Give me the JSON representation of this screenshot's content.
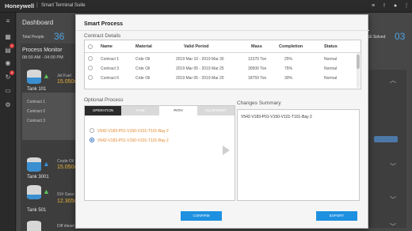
{
  "app": {
    "brand": "Honeywell",
    "separator": "|",
    "suite": "Smart Terminal Suite"
  },
  "background": {
    "dashboard_title": "Dashboard",
    "total_people_label": "Total People",
    "total_people_value": "36",
    "right_label": "SE Solved",
    "right_value": "03",
    "process_monitor_title": "Process Monitor",
    "process_monitor_time": "08:00 AM - 04:00 PM",
    "tanks": [
      {
        "material": "Jet Fuel",
        "flow": "15.050m",
        "name": "Tank 101"
      },
      {
        "material": "Crude Oil",
        "flow": "15.050m",
        "name": "Tank 3001"
      },
      {
        "material": "91# Gaso",
        "flow": "12.305m",
        "name": "Tank 501"
      },
      {
        "material": "Diff diesel",
        "flow": "",
        "name": ""
      }
    ],
    "ops_items": [
      "Contract 1",
      "Contract 2",
      "Contract 3"
    ],
    "nav_badges": [
      "1",
      "4"
    ]
  },
  "modal": {
    "title": "Smart Process",
    "contract_details": {
      "title": "Contract Details",
      "columns": [
        "Name",
        "Material",
        "Valid Period",
        "Mass",
        "Completion",
        "Status"
      ],
      "rows": [
        {
          "name": "Contract 1",
          "material": "Crde Oil",
          "period": "2019 Mar 10 - 2019 Mar 30",
          "mass": "12370 Ton",
          "completion": "25%",
          "status": "Normal"
        },
        {
          "name": "Contract 3",
          "material": "Crde Oil",
          "period": "2019 Mar 05 - 2019 Mar 25",
          "mass": "30500 Ton",
          "completion": "75%",
          "status": "Normal"
        },
        {
          "name": "Contract 6",
          "material": "Crde Oil",
          "period": "2019 Mar 05 - 2019 Mar 20",
          "mass": "18759 Ton",
          "completion": "30%",
          "status": "Normal"
        }
      ]
    },
    "optional_process": {
      "title": "Optional Process",
      "tabs": [
        "OPERATION",
        "TANK",
        "PATH",
        "EQUIPMENT"
      ],
      "options": [
        "V542-V183-P01-V150-V101-T101-Bay 2",
        "V542-V183-P01-V150-V101-T101-Bay 2"
      ],
      "selected_index": 1
    },
    "changes_summary": {
      "title": "Changes Summary",
      "text": "V542-V183-P01-V150-V101-T101-Bay 2"
    },
    "confirm_label": "CONFIRM",
    "export_label": "EXPORT"
  },
  "colors": {
    "accent_blue": "#1e90e0",
    "option_orange": "#e0862a",
    "active_tab": "#2b2b2b"
  }
}
